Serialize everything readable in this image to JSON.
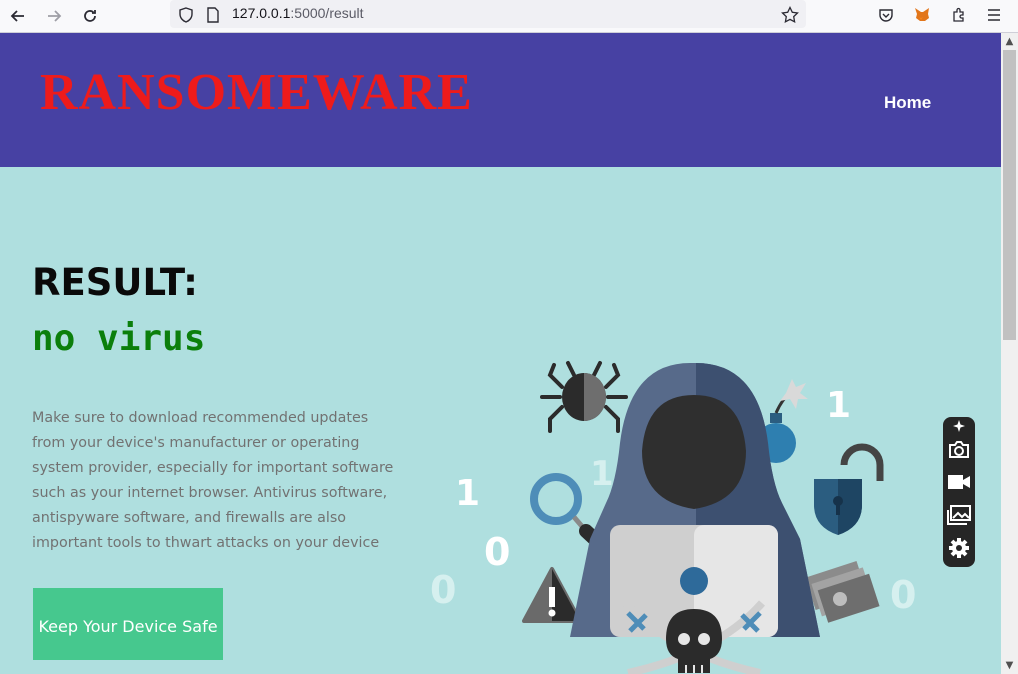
{
  "browser": {
    "url_host": "127.0.0.1",
    "url_path": ":5000/result"
  },
  "header": {
    "brand": "RANSOMEWARE",
    "nav_home": "Home"
  },
  "result": {
    "title": "RESULT:",
    "value": "no virus",
    "advice": "Make sure to download recommended updates from your device's manufacturer or operating system provider, especially for important software such as your internet browser. Antivirus software, antispyware software, and firewalls are also important tools to thwart attacks on your device",
    "cta_label": "Keep Your Device Safe"
  },
  "hero": {
    "digits": [
      "1",
      "1",
      "1",
      "0",
      "0",
      "0"
    ]
  },
  "colors": {
    "header_bg": "#4741a3",
    "brand": "#ee1b1b",
    "page_bg": "#afdfdf",
    "result_value": "#0b7f0b",
    "cta_bg": "#46c88e"
  },
  "icons": {
    "back": "arrow-left-icon",
    "forward": "arrow-right-icon",
    "reload": "reload-icon",
    "shield": "shield-icon",
    "page": "page-icon",
    "bookmark": "star-icon",
    "pocket": "pocket-icon",
    "metamask": "metamask-fox-icon",
    "extensions": "puzzle-icon",
    "menu": "hamburger-menu-icon",
    "screenshot": "camera-icon",
    "record": "video-icon",
    "gallery": "gallery-icon",
    "settings": "gear-icon"
  }
}
